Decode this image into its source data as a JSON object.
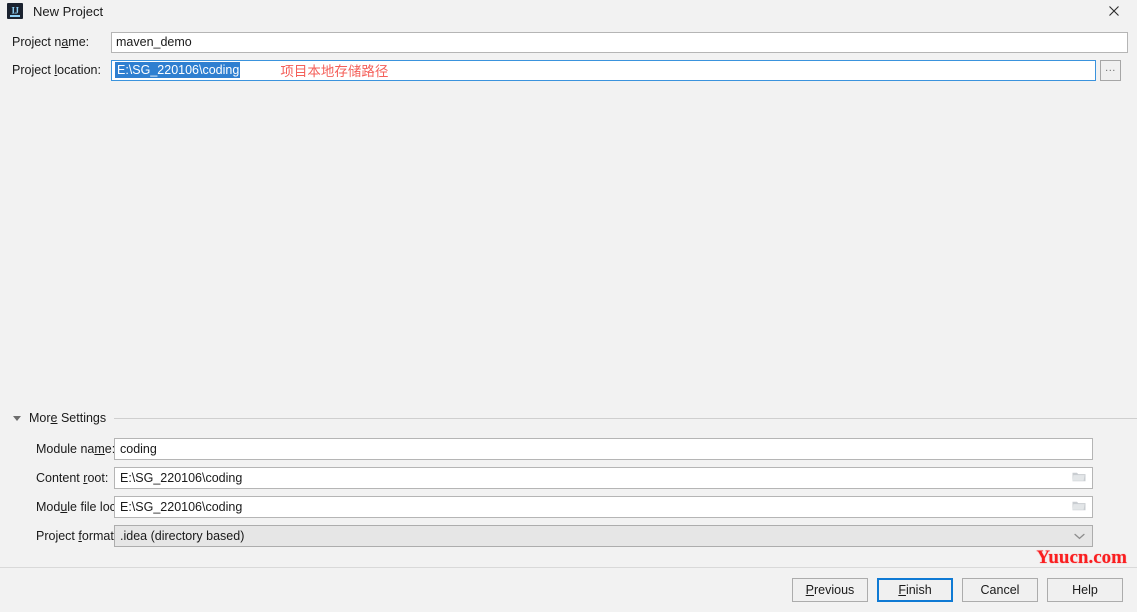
{
  "window": {
    "title": "New Project",
    "app_icon": "intellij-idea-logo",
    "close_icon": "close-icon"
  },
  "form": {
    "project_name": {
      "label": "Project name:",
      "label_mnemonic": "a",
      "value": "maven_demo",
      "placeholder": ""
    },
    "project_location": {
      "label": "Project location:",
      "label_mnemonic": "l",
      "value": "E:\\SG_220106\\coding",
      "selected": true,
      "browse_label": "...",
      "browse_icon": "ellipsis-icon"
    },
    "annotation": "项目本地存储路径",
    "annotation_color": "#f4605a"
  },
  "more_settings": {
    "label": "More Settings",
    "label_mnemonic": "e",
    "expanded": true,
    "collapse_icon": "triangle-down-icon",
    "fields": [
      {
        "label": "Module name:",
        "label_mnemonic": "m",
        "value": "coding",
        "type": "text",
        "icon": ""
      },
      {
        "label": "Content root:",
        "label_mnemonic": "r",
        "value": "E:\\SG_220106\\coding",
        "type": "text-with-browse",
        "icon": "folder-icon"
      },
      {
        "label": "Module file location:",
        "label_mnemonic": "u",
        "value": "E:\\SG_220106\\coding",
        "type": "text-with-browse",
        "icon": "folder-icon"
      },
      {
        "label": "Project format:",
        "label_mnemonic": "f",
        "value": ".idea (directory based)",
        "type": "combo",
        "icon": "chevron-down-icon"
      }
    ]
  },
  "buttons": [
    {
      "label": "Previous",
      "mnemonic": "P",
      "name": "previous-button",
      "default": false
    },
    {
      "label": "Finish",
      "mnemonic": "F",
      "name": "finish-button",
      "default": true
    },
    {
      "label": "Cancel",
      "mnemonic": "",
      "name": "cancel-button",
      "default": false
    },
    {
      "label": "Help",
      "mnemonic": "",
      "name": "help-button",
      "default": false
    }
  ],
  "watermark": {
    "text": "Yuucn.com",
    "color": "#fa1e20"
  },
  "colors": {
    "background": "#f2f2f2",
    "field_background": "#ffffff",
    "field_border": "#b5b5b5",
    "focus_border": "#3a93dd",
    "selection": "#2f7fd0",
    "accent": "#0f7ad4",
    "annotation_red": "#f4605a"
  }
}
